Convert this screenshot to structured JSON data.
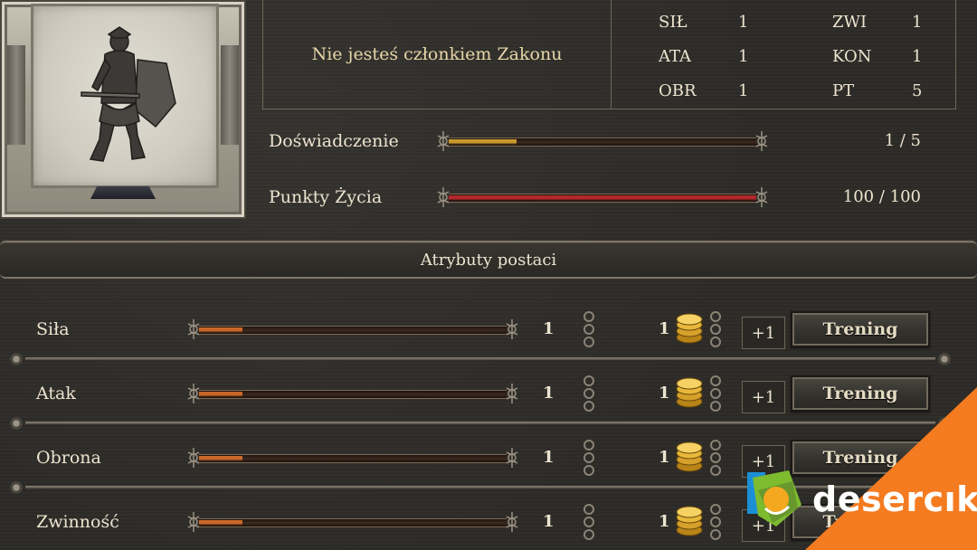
{
  "order": {
    "status_text": "Nie jesteś członkiem Zakonu"
  },
  "stats": [
    {
      "label": "SIŁ",
      "value": "1"
    },
    {
      "label": "ZWI",
      "value": "1"
    },
    {
      "label": "ATA",
      "value": "1"
    },
    {
      "label": "KON",
      "value": "1"
    },
    {
      "label": "OBR",
      "value": "1"
    },
    {
      "label": "PT",
      "value": "5"
    }
  ],
  "experience": {
    "label": "Doświadczenie",
    "value_text": "1 / 5",
    "fraction": 0.22,
    "color": "#c99a2e"
  },
  "health": {
    "label": "Punkty Życia",
    "value_text": "100 / 100",
    "fraction": 1.0,
    "color": "#b3292b"
  },
  "attributes_section": {
    "title": "Atrybuty postaci"
  },
  "attributes": [
    {
      "label": "Siła",
      "value": "1",
      "cost": "1",
      "plus_label": "+1",
      "train_label": "Trening",
      "fraction": 0.14
    },
    {
      "label": "Atak",
      "value": "1",
      "cost": "1",
      "plus_label": "+1",
      "train_label": "Trening",
      "fraction": 0.14
    },
    {
      "label": "Obrona",
      "value": "1",
      "cost": "1",
      "plus_label": "+1",
      "train_label": "Trening",
      "fraction": 0.14
    },
    {
      "label": "Zwinność",
      "value": "1",
      "cost": "1",
      "plus_label": "+1",
      "train_label": "Trening",
      "fraction": 0.14
    }
  ],
  "attribute_bar_color": "#c9672a",
  "watermark": {
    "brand": "desercık",
    "accent": "#f47b20"
  },
  "icons": {
    "portrait": "knight-with-shield-icon",
    "coin": "gold-coins-icon",
    "ornament": "ornament-icon"
  }
}
